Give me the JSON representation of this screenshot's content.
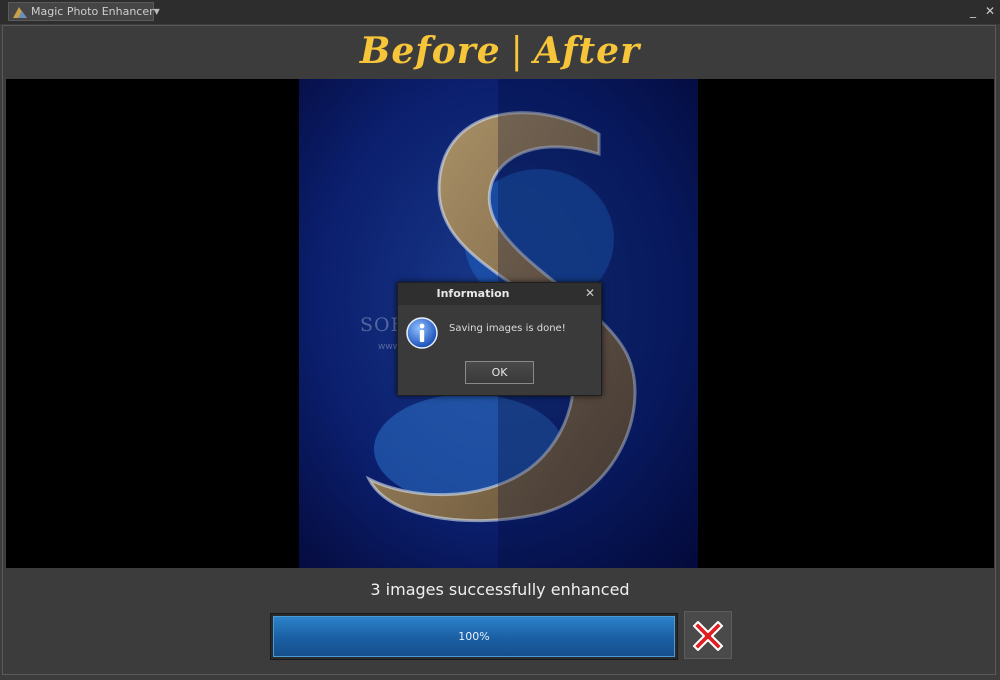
{
  "window": {
    "app_menu_label": "Magic Photo Enhancer",
    "minimize_glyph": "_",
    "close_glyph": "✕"
  },
  "heading": {
    "before": "Before",
    "separator": "|",
    "after": "After",
    "color": "#f7c53a"
  },
  "watermark": {
    "text": "SOFTPEDIA",
    "url": "www.softpedia.com"
  },
  "dialog": {
    "title": "Information",
    "message": "Saving images is done!",
    "ok_label": "OK",
    "close_glyph": "✕",
    "icon": "info-icon"
  },
  "status": {
    "message": "3 images successfully enhanced"
  },
  "progress": {
    "percent": 100,
    "label": "100%",
    "color": "#1a5fa3"
  },
  "cancel_button": {
    "icon": "red-x-icon",
    "color": "#e02020"
  }
}
